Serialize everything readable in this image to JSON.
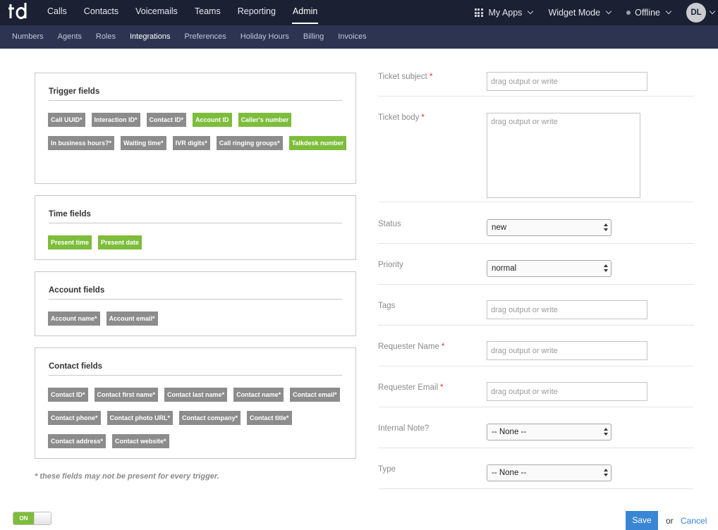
{
  "header": {
    "logo_text": "td",
    "nav": [
      "Calls",
      "Contacts",
      "Voicemails",
      "Teams",
      "Reporting",
      "Admin"
    ],
    "active_nav": "Admin",
    "my_apps": "My Apps",
    "widget_mode": "Widget Mode",
    "status": "Offline",
    "avatar_initials": "DL"
  },
  "subnav": {
    "items": [
      "Numbers",
      "Agents",
      "Roles",
      "Integrations",
      "Preferences",
      "Holiday Hours",
      "Billing",
      "Invoices"
    ],
    "active": "Integrations"
  },
  "panels": {
    "trigger": {
      "title": "Trigger fields",
      "tags": [
        {
          "label": "Call UUID*",
          "color": "grey"
        },
        {
          "label": "Interaction ID*",
          "color": "grey"
        },
        {
          "label": "Contact ID*",
          "color": "grey"
        },
        {
          "label": "Account ID",
          "color": "green"
        },
        {
          "label": "Caller's number",
          "color": "green"
        },
        {
          "label": "In business hours?*",
          "color": "grey"
        },
        {
          "label": "Waiting time*",
          "color": "grey"
        },
        {
          "label": "IVR digits*",
          "color": "grey"
        },
        {
          "label": "Call ringing groups*",
          "color": "grey"
        },
        {
          "label": "Talkdesk number",
          "color": "green"
        }
      ]
    },
    "time": {
      "title": "Time fields",
      "tags": [
        {
          "label": "Present time",
          "color": "green"
        },
        {
          "label": "Present date",
          "color": "green"
        }
      ]
    },
    "account": {
      "title": "Account fields",
      "tags": [
        {
          "label": "Account name*",
          "color": "grey"
        },
        {
          "label": "Account email*",
          "color": "grey"
        }
      ]
    },
    "contact": {
      "title": "Contact fields",
      "tags": [
        {
          "label": "Contact ID*",
          "color": "grey"
        },
        {
          "label": "Contact first name*",
          "color": "grey"
        },
        {
          "label": "Contact last name*",
          "color": "grey"
        },
        {
          "label": "Contact name*",
          "color": "grey"
        },
        {
          "label": "Contact email*",
          "color": "grey"
        },
        {
          "label": "Contact phone*",
          "color": "grey"
        },
        {
          "label": "Contact photo URL*",
          "color": "grey"
        },
        {
          "label": "Contact company*",
          "color": "grey"
        },
        {
          "label": "Contact title*",
          "color": "grey"
        },
        {
          "label": "Contact address*",
          "color": "grey"
        },
        {
          "label": "Contact website*",
          "color": "grey"
        }
      ]
    }
  },
  "footnote": "* these fields may not be present for every trigger.",
  "form": {
    "placeholder": "drag output or write",
    "ticket_subject": {
      "label": "Ticket subject",
      "required": "*"
    },
    "ticket_body": {
      "label": "Ticket body",
      "required": "*"
    },
    "status": {
      "label": "Status",
      "value": "new"
    },
    "priority": {
      "label": "Priority",
      "value": "normal"
    },
    "tags": {
      "label": "Tags"
    },
    "requester_name": {
      "label": "Requester Name",
      "required": "*"
    },
    "requester_email": {
      "label": "Requester Email",
      "required": "*"
    },
    "internal_note": {
      "label": "Internal Note?",
      "value": "-- None --"
    },
    "type": {
      "label": "Type",
      "value": "-- None --"
    }
  },
  "footer": {
    "toggle_label": "ON",
    "save_label": "Save",
    "or_text": "or",
    "cancel_label": "Cancel"
  },
  "colors": {
    "topbar": "#1b2033",
    "subbar": "#2c3452",
    "tag_grey": "#8c8c8c",
    "tag_green": "#7dbd3b",
    "required": "#d0312d",
    "primary": "#3a86d4"
  }
}
